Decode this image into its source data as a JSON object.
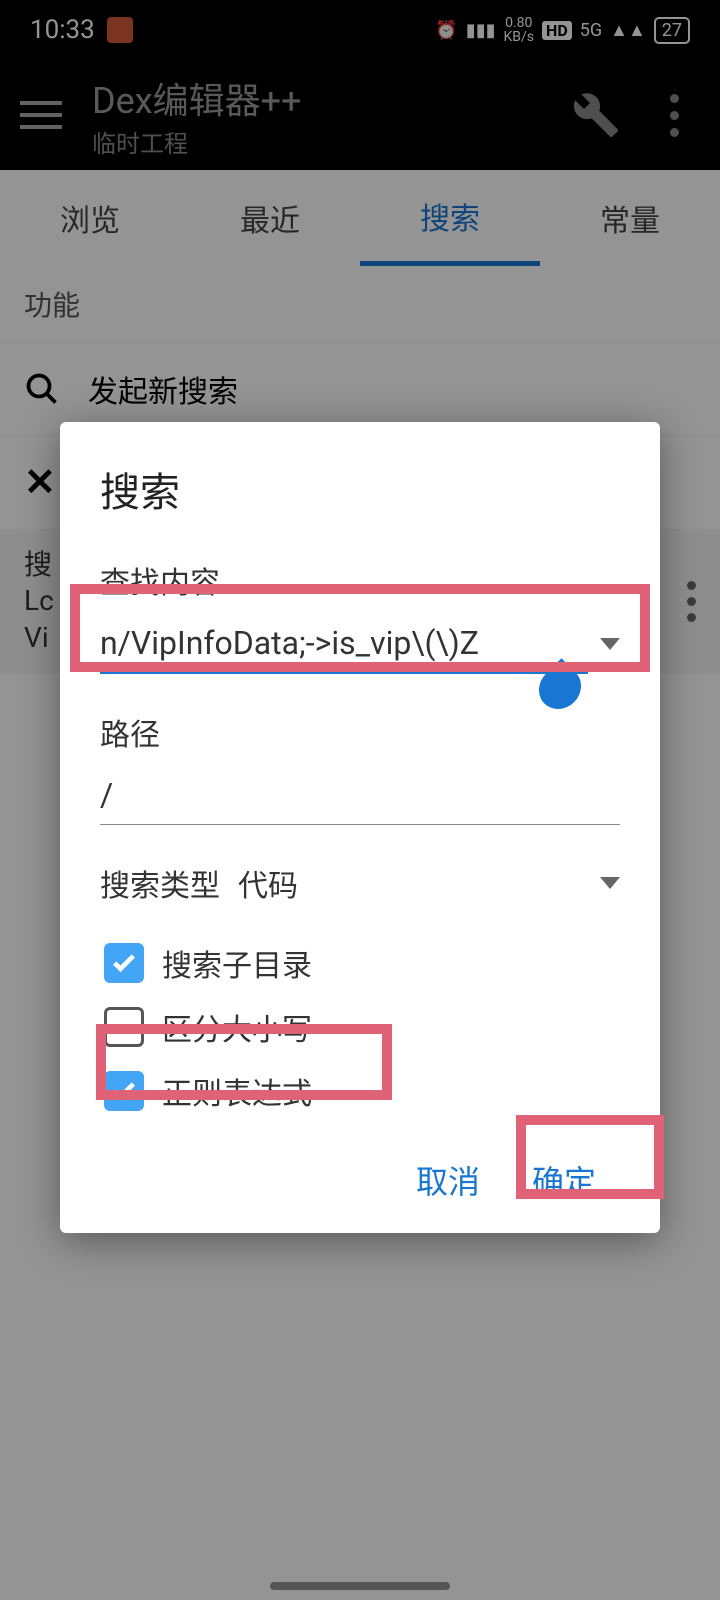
{
  "status": {
    "time": "10:33",
    "net_speed": "0.80",
    "net_unit": "KB/s",
    "hd": "HD",
    "net_type": "5G",
    "battery": "27"
  },
  "appbar": {
    "title": "Dex编辑器++",
    "subtitle": "临时工程"
  },
  "tabs": {
    "browse": "浏览",
    "recent": "最近",
    "search": "搜索",
    "const": "常量"
  },
  "section": {
    "func": "功能",
    "new_search": "发起新搜索"
  },
  "result": {
    "label": "搜",
    "line1": "Lc",
    "line2": "Vi"
  },
  "dialog": {
    "title": "搜索",
    "find_label": "查找内容",
    "find_value": "n/VipInfoData;->is_vip\\(\\)Z",
    "path_label": "路径",
    "path_value": "/",
    "type_label": "搜索类型",
    "type_value": "代码",
    "cb_sub": "搜索子目录",
    "cb_case": "区分大小写",
    "cb_regex": "正则表达式",
    "cancel": "取消",
    "ok": "确定"
  }
}
